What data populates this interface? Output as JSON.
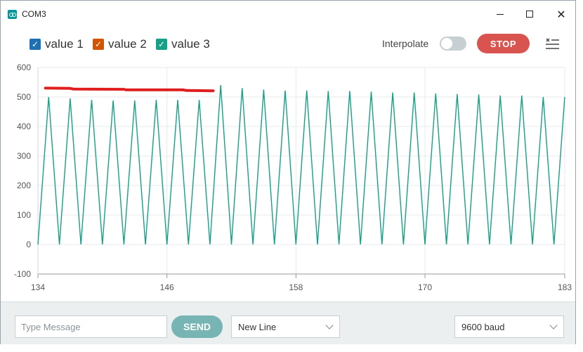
{
  "window": {
    "title": "COM3"
  },
  "legend": [
    {
      "label": "value 1",
      "color": "#1f6fb3",
      "checked": true
    },
    {
      "label": "value 2",
      "color": "#d35400",
      "checked": true
    },
    {
      "label": "value 3",
      "color": "#16a085",
      "checked": true
    }
  ],
  "controls": {
    "interpolate_label": "Interpolate",
    "interpolate_on": false,
    "stop_label": "STOP"
  },
  "bottom": {
    "message_placeholder": "Type Message",
    "send_label": "SEND",
    "line_ending": "New Line",
    "baud": "9600 baud"
  },
  "icons": {
    "app": "arduino-icon",
    "clear": "clear-list-icon"
  },
  "chart_data": {
    "type": "line",
    "title": "",
    "xlabel": "",
    "ylabel": "",
    "xlim": [
      134,
      183
    ],
    "ylim": [
      -100,
      600
    ],
    "xticks": [
      "134",
      "146",
      "158",
      "170",
      "183"
    ],
    "yticks": [
      "600",
      "500",
      "400",
      "300",
      "200",
      "100",
      "0",
      "-100"
    ],
    "grid": true,
    "series": [
      {
        "color": "#16a085",
        "x": [
          134,
          135,
          136,
          137,
          138,
          139,
          140,
          141,
          142,
          143,
          144,
          145,
          146,
          147,
          148,
          149,
          150,
          151,
          152,
          153,
          154,
          155,
          156,
          157,
          158,
          159,
          160,
          161,
          162,
          163,
          164,
          165,
          166,
          167,
          168,
          169,
          170,
          171,
          172,
          173,
          174,
          175,
          176,
          177,
          178,
          179,
          180,
          181,
          182,
          183
        ],
        "y": [
          0,
          500,
          0,
          495,
          0,
          490,
          0,
          488,
          0,
          488,
          0,
          490,
          0,
          490,
          0,
          490,
          0,
          540,
          0,
          530,
          0,
          525,
          0,
          522,
          0,
          522,
          0,
          520,
          0,
          520,
          0,
          518,
          0,
          515,
          0,
          515,
          0,
          512,
          0,
          510,
          0,
          508,
          0,
          505,
          0,
          505,
          0,
          500,
          0,
          500
        ]
      }
    ],
    "annotation_lines": [
      {
        "color": "#e02020",
        "points": [
          [
            134.7,
            530
          ],
          [
            137,
            529
          ],
          [
            137.3,
            527
          ],
          [
            142,
            526
          ],
          [
            142.2,
            524
          ],
          [
            147.5,
            524
          ],
          [
            147.8,
            522
          ],
          [
            150.3,
            521
          ]
        ]
      }
    ]
  }
}
